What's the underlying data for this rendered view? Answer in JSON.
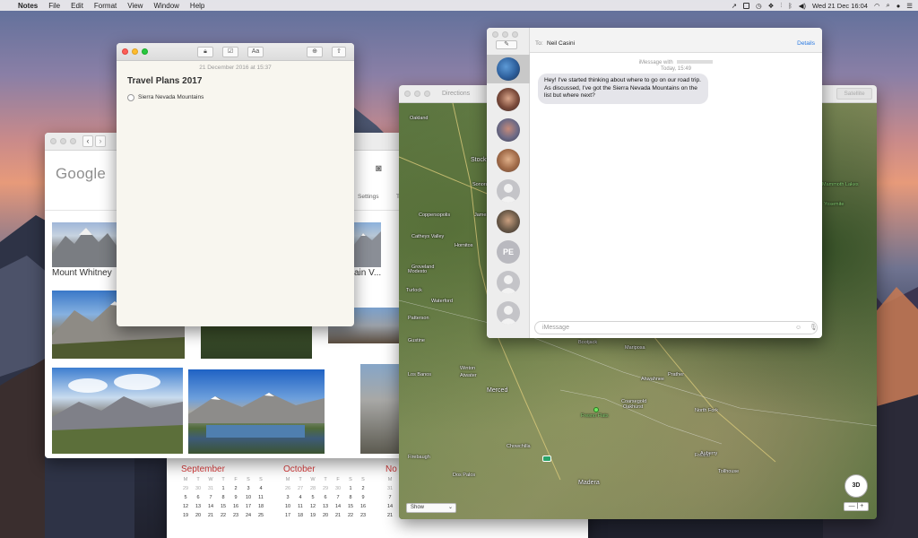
{
  "menubar": {
    "app_name": "Notes",
    "items": [
      "File",
      "Edit",
      "Format",
      "View",
      "Window",
      "Help"
    ],
    "datetime": "Wed 21 Dec  16:04"
  },
  "safari": {
    "logo_text": "Google",
    "camera_icon": "camera-icon",
    "settings_label": "Settings",
    "tab_partial": "T",
    "caption_1": "Mount Whitney",
    "caption_2": "ain V..."
  },
  "notes": {
    "timestamp": "21 December 2016 at 15:37",
    "title": "Travel Plans 2017",
    "checklist": [
      {
        "text": "Sierra Nevada Mountains",
        "checked": false
      }
    ]
  },
  "calendar": {
    "months": [
      "September",
      "October",
      "No"
    ],
    "weekday_headers": [
      "M",
      "T",
      "W",
      "T",
      "F",
      "S",
      "S"
    ],
    "september_rows": [
      [
        "29",
        "30",
        "31",
        "1",
        "2",
        "3",
        "4"
      ],
      [
        "5",
        "6",
        "7",
        "8",
        "9",
        "10",
        "11"
      ],
      [
        "12",
        "13",
        "14",
        "15",
        "16",
        "17",
        "18"
      ],
      [
        "19",
        "20",
        "21",
        "22",
        "23",
        "24",
        "25"
      ]
    ],
    "october_rows": [
      [
        "26",
        "27",
        "28",
        "29",
        "30",
        "1",
        "2"
      ],
      [
        "3",
        "4",
        "5",
        "6",
        "7",
        "8",
        "9"
      ],
      [
        "10",
        "11",
        "12",
        "13",
        "14",
        "15",
        "16"
      ],
      [
        "17",
        "18",
        "19",
        "20",
        "21",
        "22",
        "23"
      ]
    ],
    "november_rows": [
      [
        "31",
        "1"
      ],
      [
        "7",
        "8"
      ],
      [
        "14",
        "15"
      ],
      [
        "21",
        "22"
      ]
    ]
  },
  "maps": {
    "toolbar_label": "Directions",
    "satellite_button": "Satellite",
    "show_select": "Show",
    "compass_label": "3D",
    "places": [
      "Oakland",
      "Stockton",
      "Coppersopolis",
      "Jamestown",
      "Sonora",
      "Turlock",
      "Modesto",
      "Waterford",
      "Patterson",
      "Gustine",
      "Los Banos",
      "Merced",
      "Atwater",
      "Winton",
      "Chowchilla",
      "Madera",
      "Fresno",
      "Mariposa",
      "Oakhurst",
      "Coarsegold",
      "North Fork",
      "Auberry",
      "Prather",
      "Tollhouse",
      "Dos Palos",
      "Firebaugh",
      "Mammoth Lakes",
      "Ahwahnee",
      "Bootjack",
      "Groveland",
      "Catheys Valley",
      "Yosemite",
      "Hornitos"
    ],
    "pin_label": "Fresno Flats"
  },
  "messages": {
    "to_label": "To:",
    "to_name": "Neil Casini",
    "details_label": "Details",
    "service_label": "iMessage with",
    "time_label": "Today, 15:49",
    "message_text": "Hey! I've started thinking about where to go on our road trip. As discussed, I've got the Sierra Nevada Mountains on the list but where next?",
    "composer_placeholder": "iMessage",
    "initials_avatar": "PE"
  },
  "colors": {
    "accent_red": "#d63b3b",
    "messages_link": "#2a7ae2",
    "traffic_red": "#fd5f57",
    "traffic_yellow": "#febc2e",
    "traffic_green": "#28c840"
  }
}
